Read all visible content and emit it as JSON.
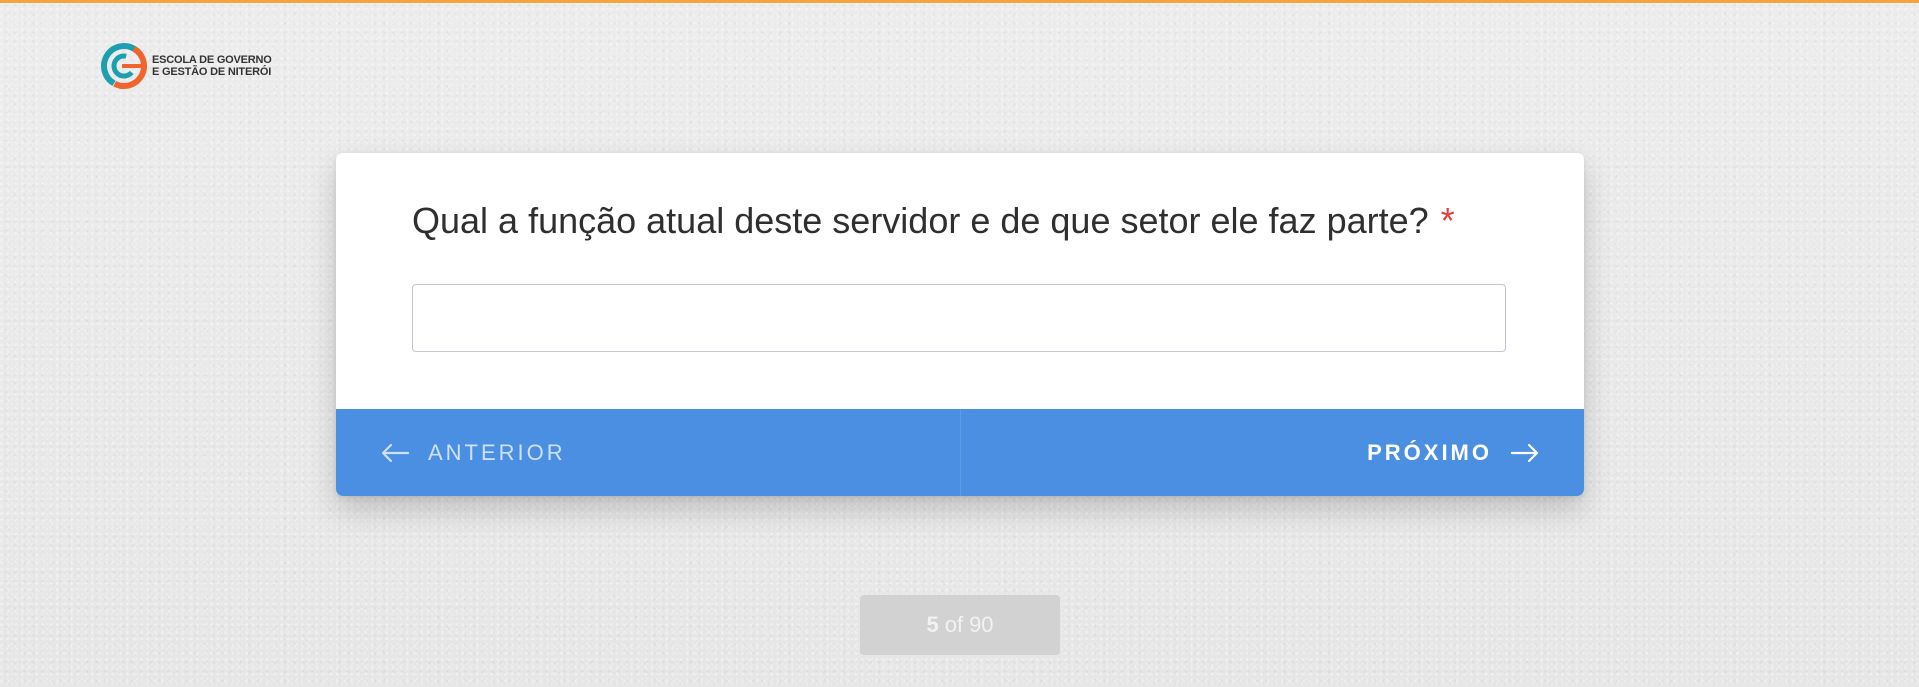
{
  "brand": {
    "logo_line1": "ESCOLA DE GOVERNO",
    "logo_line2": "E GESTÃO DE NITERÓI",
    "logo_icon": "egg-logo-icon"
  },
  "colors": {
    "accent_orange": "#f5a33a",
    "primary_blue": "#4a8fe2",
    "required_red": "#e0413a",
    "nav_prev_text": "#cfe0f7",
    "nav_next_text": "#ffffff",
    "pager_bg": "#d2d2d2",
    "pager_text": "#f2f2f2",
    "logo_teal": "#1e9fb0",
    "logo_orange": "#f0652d"
  },
  "form": {
    "question": "Qual a função atual deste servidor e de que setor ele faz parte?",
    "required_mark": "*",
    "answer_value": "",
    "answer_placeholder": ""
  },
  "navigation": {
    "prev_label": "ANTERIOR",
    "prev_icon": "arrow-left-icon",
    "next_label": "PRÓXIMO",
    "next_icon": "arrow-right-icon"
  },
  "pager": {
    "current": "5",
    "separator": "of",
    "total": "90"
  }
}
